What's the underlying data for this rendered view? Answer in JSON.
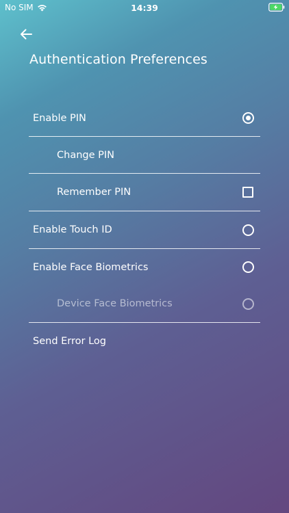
{
  "status_bar": {
    "carrier": "No SIM",
    "time": "14:39",
    "wifi_icon": "wifi-icon",
    "battery_icon": "battery-charging-icon",
    "battery_color": "#4cd964"
  },
  "header": {
    "back_icon": "arrow-left-icon",
    "title": "Authentication Preferences"
  },
  "settings": {
    "enable_pin": {
      "label": "Enable PIN",
      "control": "radio",
      "selected": true
    },
    "change_pin": {
      "label": "Change PIN"
    },
    "remember_pin": {
      "label": "Remember PIN",
      "control": "checkbox",
      "checked": false
    },
    "enable_touch_id": {
      "label": "Enable Touch ID",
      "control": "radio",
      "selected": false
    },
    "enable_face_biometrics": {
      "label": "Enable Face Biometrics",
      "control": "radio",
      "selected": false
    },
    "device_face_biometrics": {
      "label": "Device Face Biometrics",
      "control": "radio",
      "selected": false,
      "disabled": true
    },
    "send_error_log": {
      "label": "Send Error Log"
    }
  }
}
